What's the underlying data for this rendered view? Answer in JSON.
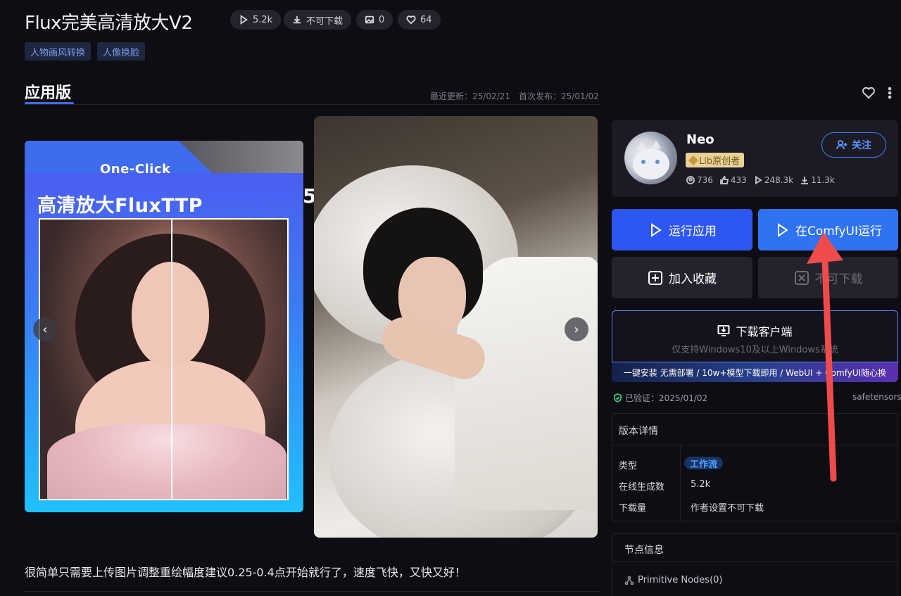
{
  "header": {
    "title": "Flux完美高清放大V2",
    "stats": [
      {
        "icon": "play-icon",
        "label": "5.2k"
      },
      {
        "icon": "download-icon",
        "label": "不可下载"
      },
      {
        "icon": "image-icon",
        "label": "0"
      },
      {
        "icon": "heart-icon",
        "label": "64"
      }
    ],
    "tags": [
      "人物画风转换",
      "人像换脸"
    ]
  },
  "tabs": {
    "active": "应用版",
    "last_updated": "最近更新：25/02/21",
    "first_published": "首次发布：25/01/02"
  },
  "gallery": {
    "card1_kicker": "One-Click",
    "card1_headline": "高清放大FluxTTP",
    "card1_peek": "5",
    "prev_label": "‹",
    "next_label": "›"
  },
  "description": "很简单只需要上传图片调整重绘幅度建议0.25-0.4点开始就行了，速度飞快，又快又好！",
  "author": {
    "name": "Neo",
    "badge": "Lib原创者",
    "follow_label": "关注",
    "stats": [
      {
        "icon": "user-icon",
        "value": "736"
      },
      {
        "icon": "thumbs-up-icon",
        "value": "433"
      },
      {
        "icon": "play-icon",
        "value": "248.3k"
      },
      {
        "icon": "download-icon",
        "value": "11.3k"
      }
    ]
  },
  "actions": {
    "run_app": "运行应用",
    "run_comfy": "在ComfyUI运行",
    "add_favorite": "加入收藏",
    "download": "不可下载"
  },
  "client": {
    "title": "下载客户端",
    "subtitle": "仅支持Windows10及以上Windows系统",
    "banner": "一键安装 无需部署 / 10w+模型下载即用 / WebUI + ComfyUI随心换"
  },
  "verification": {
    "verified": "已验证：2025/01/02",
    "format": "safetensors"
  },
  "version_details": {
    "heading": "版本详情",
    "rows": [
      {
        "label": "类型",
        "value": "工作流"
      },
      {
        "label": "在线生成数",
        "value": "5.2k"
      },
      {
        "label": "下载量",
        "value": "作者设置不可下载"
      }
    ]
  },
  "node_info": {
    "heading": "节点信息",
    "items": [
      "Primitive Nodes(0)"
    ]
  },
  "colors": {
    "background": "#0e0d13",
    "accent_blue": "#2d56f2",
    "annotation_red": "#f04b4b"
  }
}
